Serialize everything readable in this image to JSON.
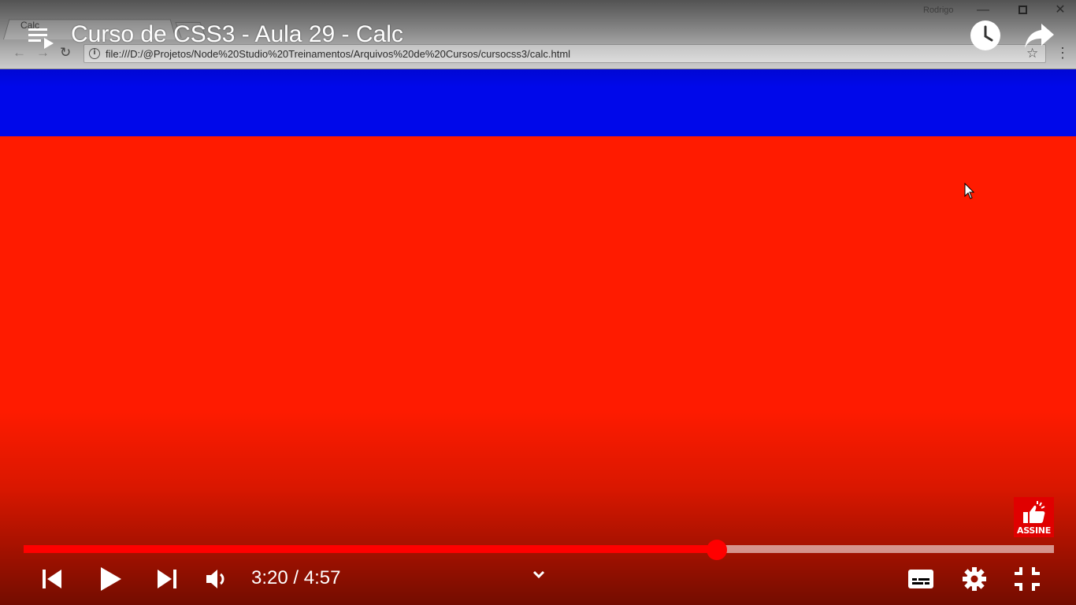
{
  "video": {
    "browser": {
      "tab_label": "Calc",
      "profile_name": "Rodrigo",
      "url": "file:///D:/@Projetos/Node%20Studio%20Treinamentos/Arquivos%20de%20Cursos/cursocss3/calc.html"
    },
    "page_colors": {
      "header_band": "#0008ea",
      "body": "#ff1b00"
    }
  },
  "player": {
    "title": "Curso de CSS3 - Aula 29 - Calc",
    "subscribe_label": "ASSINE",
    "time_display": "3:20 / 4:57",
    "progress_fraction": 0.673,
    "accent_color": "#ff0000",
    "icons": {
      "playlist": "playlist-icon",
      "watch_later": "clock-icon",
      "share": "share-arrow-icon",
      "previous": "skip-previous-icon",
      "play": "play-icon",
      "next": "skip-next-icon",
      "volume": "volume-icon",
      "expand": "chevron-down-icon",
      "subtitles": "subtitles-icon",
      "settings": "gear-icon",
      "exit_fullscreen": "exit-fullscreen-icon"
    }
  }
}
